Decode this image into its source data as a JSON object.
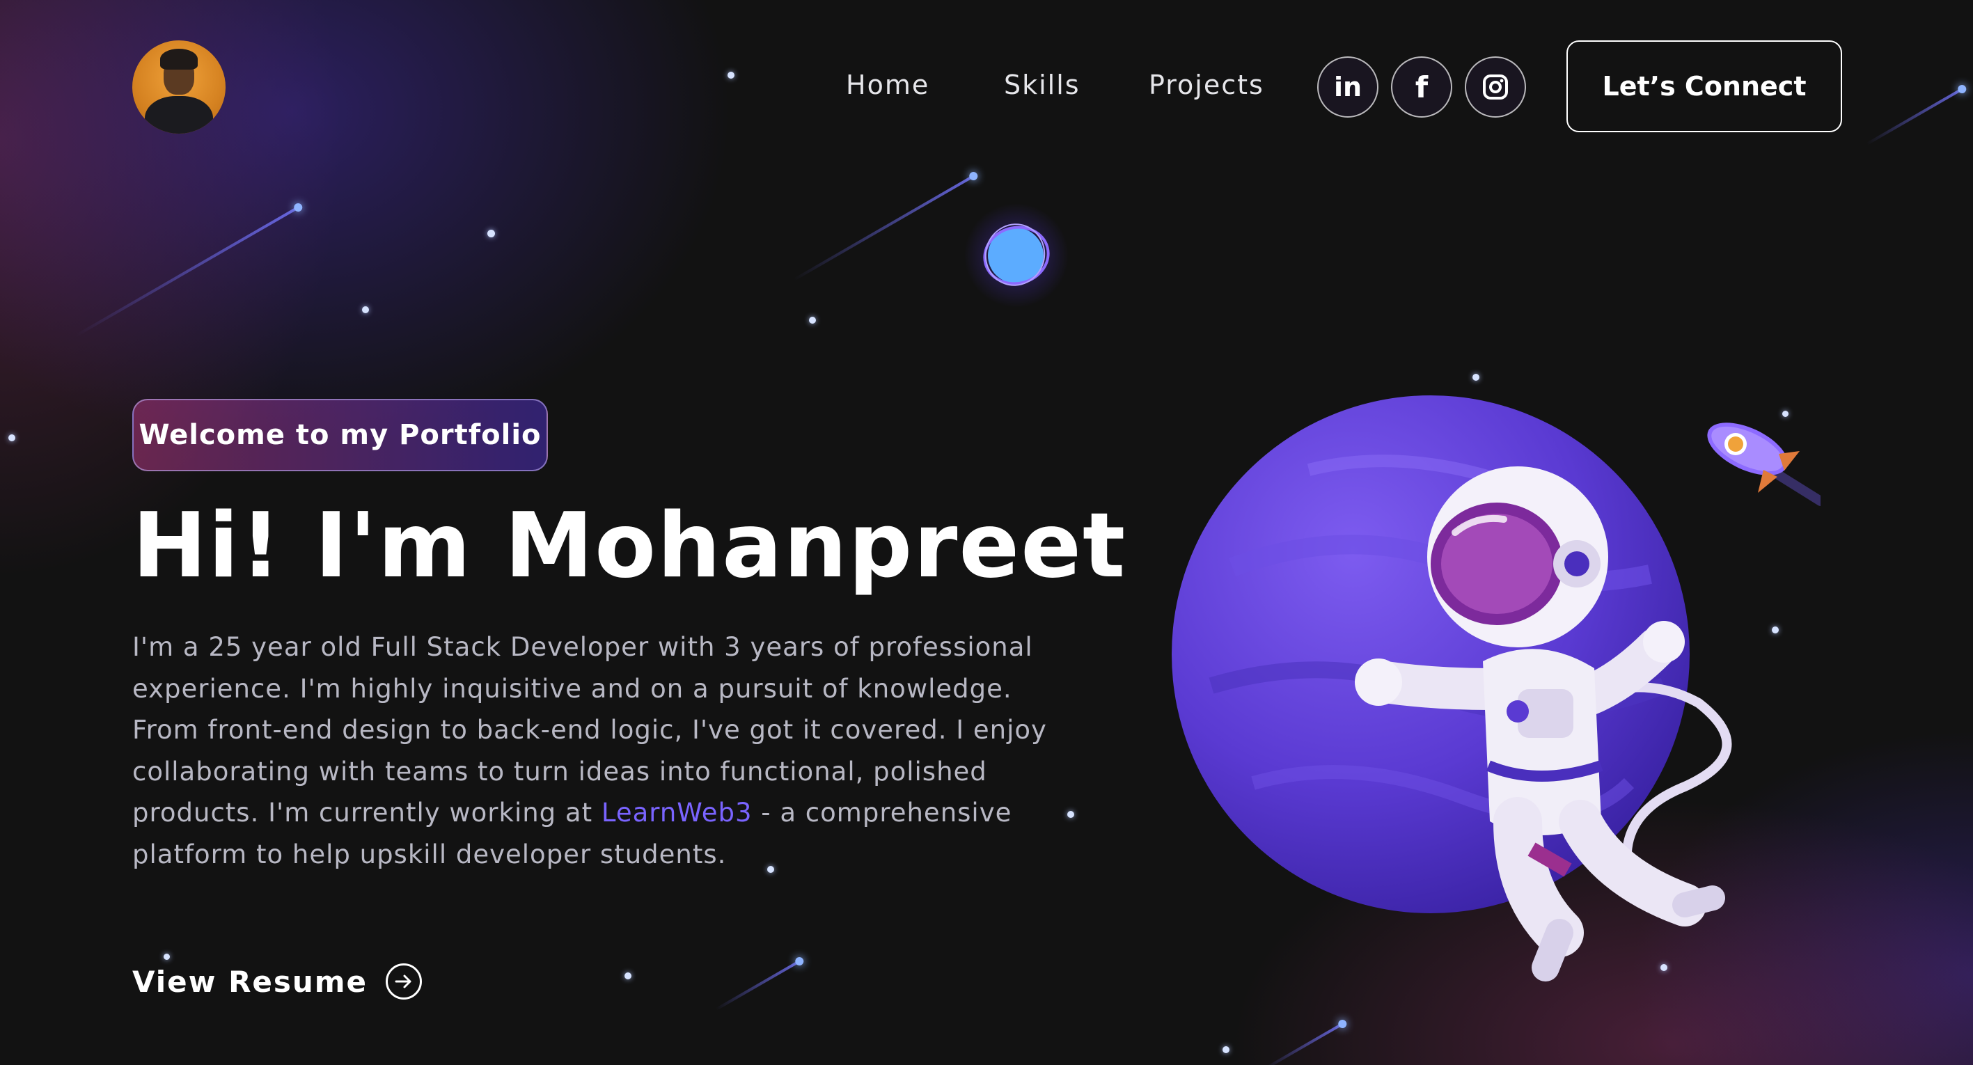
{
  "header": {
    "nav": [
      "Home",
      "Skills",
      "Projects"
    ],
    "social": [
      {
        "icon": "linkedin-icon",
        "glyph": "in"
      },
      {
        "icon": "facebook-icon",
        "glyph": "f"
      },
      {
        "icon": "instagram-icon",
        "glyph": ""
      }
    ],
    "cta_label": "Let’s Connect"
  },
  "hero": {
    "tagline": "Welcome to my Portfolio",
    "title": "Hi! I'm Mohanpreet",
    "bio_before_link": "I'm a 25 year old Full Stack Developer with 3 years of professional experience. I'm highly inquisitive and on a pursuit of knowledge. From front-end design to back-end logic, I've got it covered. I enjoy collaborating with teams to turn ideas into functional, polished products. I'm currently working at ",
    "bio_link": "LearnWeb3",
    "bio_after_link": " - a comprehensive platform to help upskill developer students.",
    "resume_label": "View Resume"
  },
  "colors": {
    "background": "#121212",
    "accent_purple": "#4a2fbd",
    "accent_pink": "#aa367c",
    "link": "#7a64ff"
  }
}
